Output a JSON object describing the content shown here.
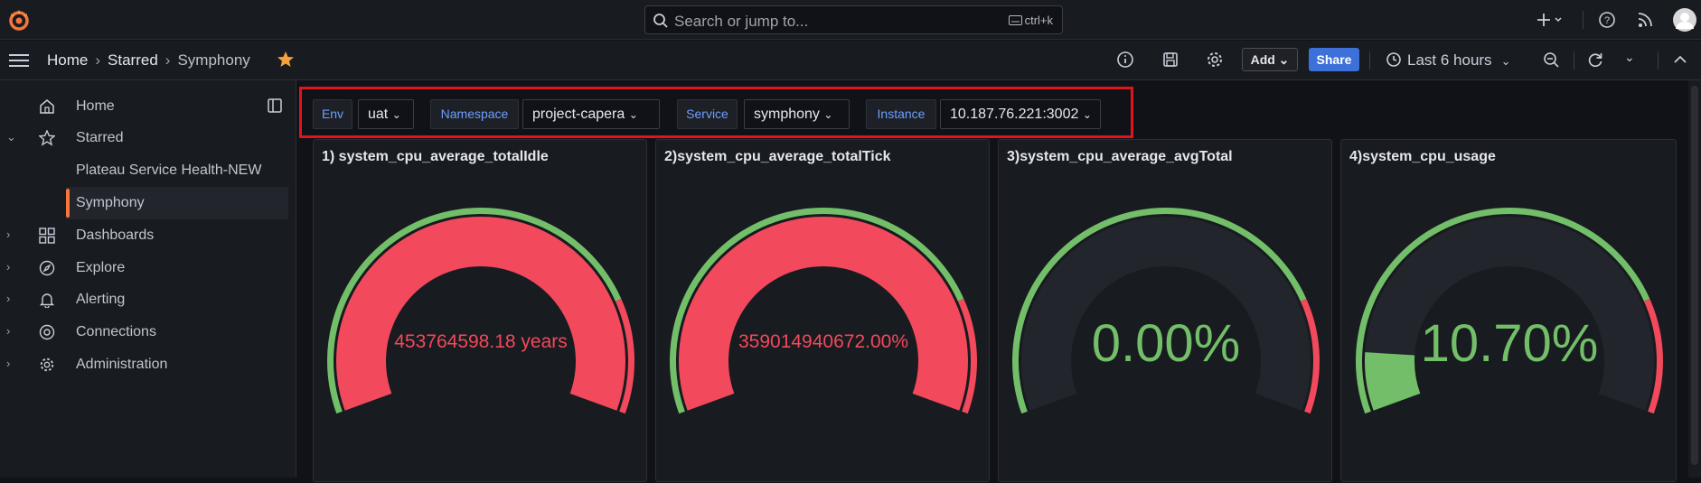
{
  "search": {
    "placeholder": "Search or jump to...",
    "shortcut": "ctrl+k"
  },
  "breadcrumb": {
    "home": "Home",
    "starred": "Starred",
    "current": "Symphony"
  },
  "toolbar": {
    "add_label": "Add",
    "share_label": "Share",
    "time_range": "Last 6 hours"
  },
  "sidebar": {
    "items": [
      {
        "label": "Home"
      },
      {
        "label": "Starred"
      },
      {
        "label": "Plateau Service Health-NEW"
      },
      {
        "label": "Symphony"
      },
      {
        "label": "Dashboards"
      },
      {
        "label": "Explore"
      },
      {
        "label": "Alerting"
      },
      {
        "label": "Connections"
      },
      {
        "label": "Administration"
      }
    ]
  },
  "variables": [
    {
      "label": "Env",
      "value": "uat"
    },
    {
      "label": "Namespace",
      "value": "project-capera"
    },
    {
      "label": "Service",
      "value": "symphony"
    },
    {
      "label": "Instance",
      "value": "10.187.76.221:3002"
    }
  ],
  "panels": [
    {
      "title": "1) system_cpu_average_totalIdle",
      "value": "453764598.18 years",
      "level": 1.0,
      "value_color": "#f2495c"
    },
    {
      "title": "2)system_cpu_average_totalTick",
      "value": "359014940672.00%",
      "level": 1.0,
      "value_color": "#f2495c"
    },
    {
      "title": "3)system_cpu_average_avgTotal",
      "value": "0.00%",
      "level": 0.0,
      "value_color": "#73bf69"
    },
    {
      "title": "4)system_cpu_usage",
      "value": "10.70%",
      "level": 0.107,
      "value_color": "#73bf69"
    }
  ],
  "colors": {
    "accent_orange": "#f5753c",
    "share_blue": "#3d71d9",
    "gauge_red": "#f2495c",
    "gauge_green": "#73bf69",
    "highlight_border": "#e0151b"
  }
}
